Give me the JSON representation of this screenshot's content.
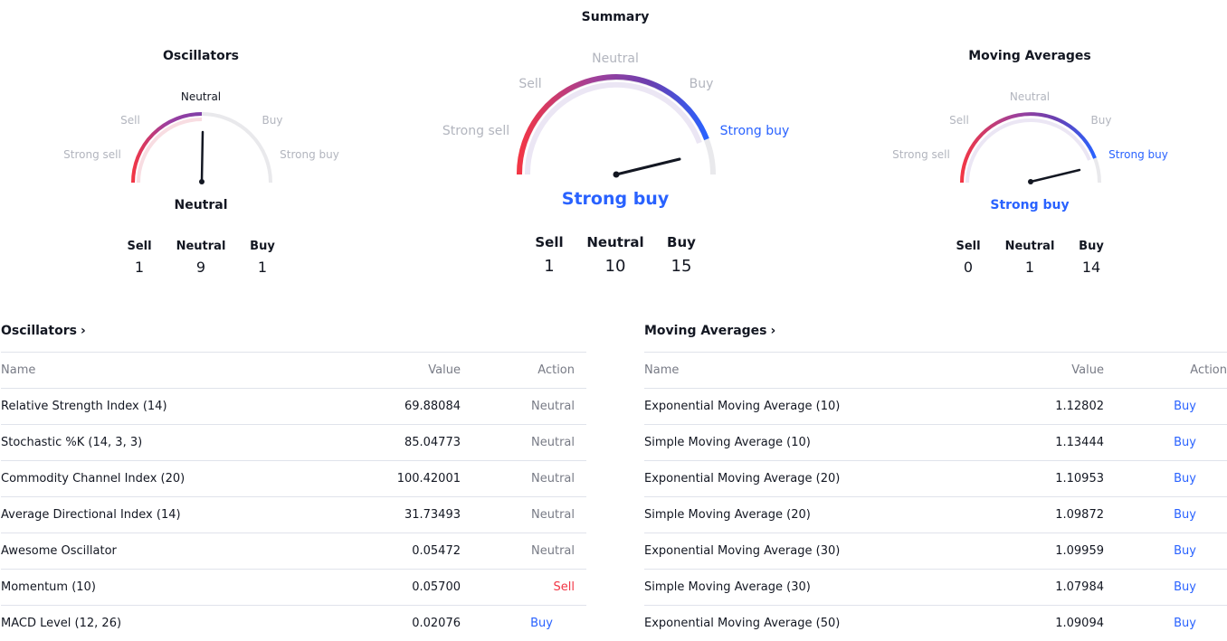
{
  "summary_title": "Summary",
  "gauges": {
    "oscillators": {
      "title": "Oscillators",
      "labels": {
        "strong_sell": "Strong sell",
        "sell": "Sell",
        "neutral": "Neutral",
        "buy": "Buy",
        "strong_buy": "Strong buy"
      },
      "verdict": "Neutral",
      "counts": [
        {
          "label": "Sell",
          "value": "1"
        },
        {
          "label": "Neutral",
          "value": "9"
        },
        {
          "label": "Buy",
          "value": "1"
        }
      ]
    },
    "summary": {
      "labels": {
        "strong_sell": "Strong sell",
        "sell": "Sell",
        "neutral": "Neutral",
        "buy": "Buy",
        "strong_buy": "Strong buy"
      },
      "verdict": "Strong buy",
      "counts": [
        {
          "label": "Sell",
          "value": "1"
        },
        {
          "label": "Neutral",
          "value": "10"
        },
        {
          "label": "Buy",
          "value": "15"
        }
      ]
    },
    "moving_averages": {
      "title": "Moving Averages",
      "labels": {
        "strong_sell": "Strong sell",
        "sell": "Sell",
        "neutral": "Neutral",
        "buy": "Buy",
        "strong_buy": "Strong buy"
      },
      "verdict": "Strong buy",
      "counts": [
        {
          "label": "Sell",
          "value": "0"
        },
        {
          "label": "Neutral",
          "value": "1"
        },
        {
          "label": "Buy",
          "value": "14"
        }
      ]
    }
  },
  "oscillators_table": {
    "title": "Oscillators",
    "headers": {
      "name": "Name",
      "value": "Value",
      "action": "Action"
    },
    "rows": [
      {
        "name": "Relative Strength Index (14)",
        "value": "69.88084",
        "action": "Neutral"
      },
      {
        "name": "Stochastic %K (14, 3, 3)",
        "value": "85.04773",
        "action": "Neutral"
      },
      {
        "name": "Commodity Channel Index (20)",
        "value": "100.42001",
        "action": "Neutral"
      },
      {
        "name": "Average Directional Index (14)",
        "value": "31.73493",
        "action": "Neutral"
      },
      {
        "name": "Awesome Oscillator",
        "value": "0.05472",
        "action": "Neutral"
      },
      {
        "name": "Momentum (10)",
        "value": "0.05700",
        "action": "Sell"
      },
      {
        "name": "MACD Level (12, 26)",
        "value": "0.02076",
        "action": "Buy"
      }
    ]
  },
  "moving_averages_table": {
    "title": "Moving Averages",
    "headers": {
      "name": "Name",
      "value": "Value",
      "action": "Action"
    },
    "rows": [
      {
        "name": "Exponential Moving Average (10)",
        "value": "1.12802",
        "action": "Buy"
      },
      {
        "name": "Simple Moving Average (10)",
        "value": "1.13444",
        "action": "Buy"
      },
      {
        "name": "Exponential Moving Average (20)",
        "value": "1.10953",
        "action": "Buy"
      },
      {
        "name": "Simple Moving Average (20)",
        "value": "1.09872",
        "action": "Buy"
      },
      {
        "name": "Exponential Moving Average (30)",
        "value": "1.09959",
        "action": "Buy"
      },
      {
        "name": "Simple Moving Average (30)",
        "value": "1.07984",
        "action": "Buy"
      },
      {
        "name": "Exponential Moving Average (50)",
        "value": "1.09094",
        "action": "Buy"
      }
    ]
  },
  "colors": {
    "sell": "#f23645",
    "buy": "#2962ff",
    "neutral_text": "#787b86",
    "inactive_label": "#b2b5be",
    "gauge_track": "#e9e9ec",
    "divider": "#e0e3eb"
  },
  "chevron_icon": "chevron-right-icon"
}
